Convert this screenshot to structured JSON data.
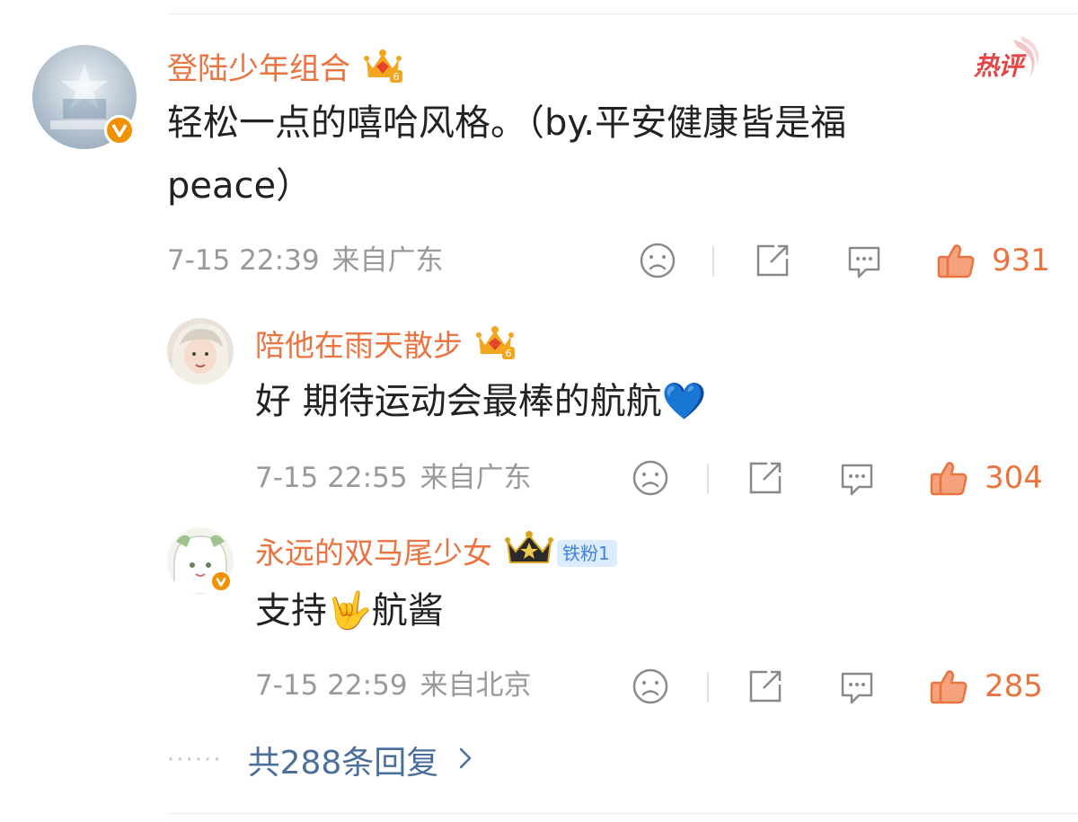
{
  "colors": {
    "name": "#eb7340",
    "meta": "#999999",
    "like": "#eb7340",
    "more_link": "#4a6f9b",
    "vip_badge": "#f29100",
    "hot_badge": "#e54545"
  },
  "main_comment": {
    "username": "登陆少年组合",
    "text": "轻松一点的嘻哈风格。（by.平安健康皆是福peace）",
    "text_line1": "轻松一点的嘻哈风格。（by.平安健康皆是福",
    "text_line2": "peace）",
    "time": "7-15 22:39",
    "location": "来自广东",
    "likes": "931",
    "badge": "热评",
    "verified": true,
    "crown_level": "6"
  },
  "replies": [
    {
      "username": "陪他在雨天散步",
      "text": "好 期待运动会最棒的航航💙",
      "time": "7-15 22:55",
      "location": "来自广东",
      "likes": "304",
      "crown_level": "6"
    },
    {
      "username": "永远的双马尾少女",
      "text": "支持🤟航酱",
      "time": "7-15 22:59",
      "location": "来自北京",
      "likes": "285",
      "verified": true,
      "fan_badge": "铁粉1"
    }
  ],
  "more_replies": {
    "label": "共288条回复",
    "icon": "chevron-right-icon"
  },
  "icons": {
    "dislike": "sad-face-icon",
    "share": "share-icon",
    "comment": "comment-bubble-icon",
    "like": "thumbs-up-icon"
  }
}
